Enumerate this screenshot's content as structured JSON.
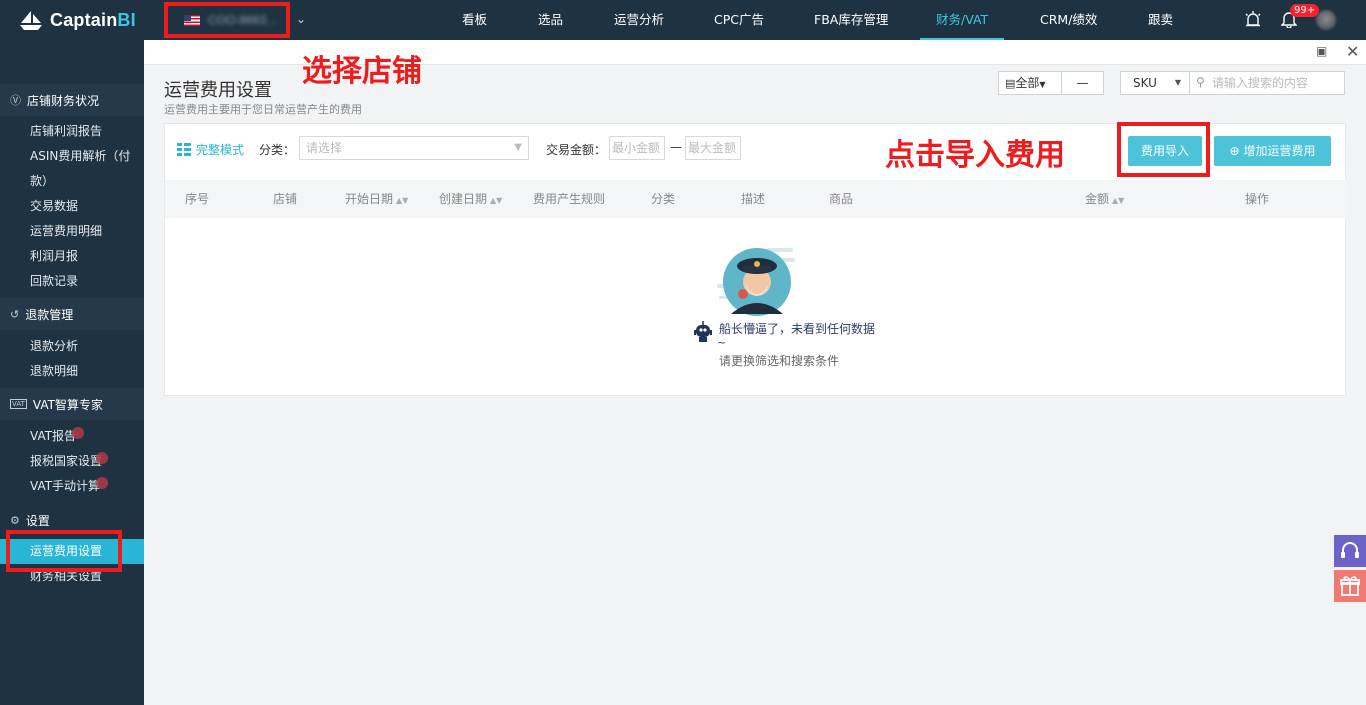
{
  "app": {
    "logo_main": "Captain",
    "logo_bi": "BI"
  },
  "store": {
    "name": "COO-8663..."
  },
  "nav": {
    "items": [
      "看板",
      "选品",
      "运营分析",
      "CPC广告",
      "FBA库存管理",
      "财务/VAT",
      "CRM/绩效",
      "跟卖"
    ],
    "active": "财务/VAT",
    "notification_count": "99+"
  },
  "sidebar": {
    "groups": [
      {
        "title": "店铺财务状况",
        "icon": "dollar-circle-icon",
        "items": [
          "店铺利润报告",
          "ASIN费用解析（付",
          "款）",
          "交易数据",
          "运营费用明细",
          "利润月报",
          "回款记录"
        ]
      },
      {
        "title": "退款管理",
        "icon": "refund-icon",
        "items": [
          "退款分析",
          "退款明细"
        ]
      },
      {
        "title": "VAT智算专家",
        "icon": "vat-icon",
        "items": [
          "VAT报告",
          "报税国家设置",
          "VAT手动计算"
        ]
      },
      {
        "title": "设置",
        "icon": "gear-icon",
        "items": [
          "运营费用设置",
          "财务相关设置"
        ]
      }
    ],
    "active_item": "运营费用设置"
  },
  "page": {
    "title": "运营费用设置",
    "subtitle": "运营费用主要用于您日常运营产生的费用"
  },
  "toolbar": {
    "scope_label": "全部",
    "dash": "—",
    "sku_label": "SKU",
    "search_placeholder": "请输入搜索的内容"
  },
  "filters": {
    "mode_link": "完整模式",
    "category_label": "分类：",
    "category_placeholder": "请选择",
    "amount_label": "交易金额：",
    "min_placeholder": "最小金额",
    "dash": "—",
    "max_placeholder": "最大金额",
    "import_button": "费用导入",
    "add_button": "增加运营费用"
  },
  "table": {
    "columns": [
      "序号",
      "店铺",
      "开始日期",
      "创建日期",
      "费用产生规则",
      "分类",
      "描述",
      "商品",
      "金额",
      "操作"
    ],
    "rows": []
  },
  "empty": {
    "line1": "船长懵逼了，未看到任何数据",
    "tilde": "~",
    "line2": "请更换筛选和搜索条件"
  },
  "annotations": {
    "select_store": "选择店铺",
    "click_import": "点击导入费用"
  },
  "colors": {
    "nav_bg": "#1f3242",
    "accent": "#29b6d6",
    "button": "#4cc3d9",
    "annotation_red": "#ee1c1c"
  }
}
